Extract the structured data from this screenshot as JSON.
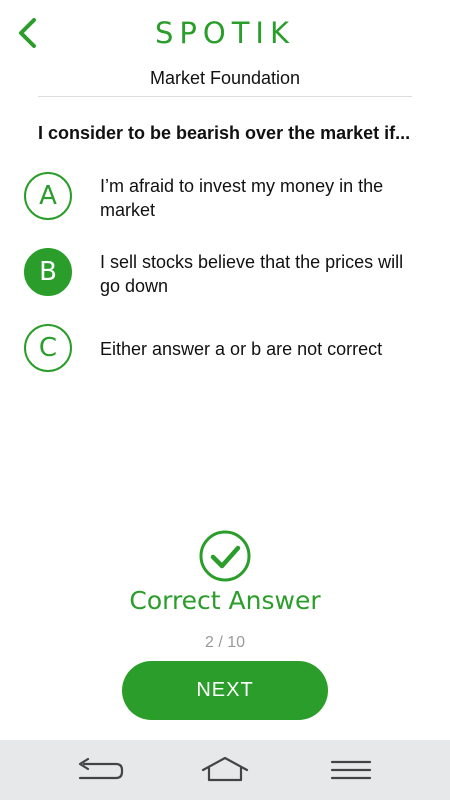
{
  "header": {
    "brand": "SPOTIK",
    "back_icon": "chevron-left-icon",
    "subtitle": "Market Foundation"
  },
  "question": {
    "text": "I consider to be bearish over the market if..."
  },
  "options": [
    {
      "letter": "A",
      "text": "I’m afraid to invest my money in the market",
      "selected": false
    },
    {
      "letter": "B",
      "text": "I sell stocks believe that the prices will go down",
      "selected": true
    },
    {
      "letter": "C",
      "text": "Either answer a or b are not correct",
      "selected": false
    }
  ],
  "result": {
    "icon": "check-circle-icon",
    "text": "Correct Answer"
  },
  "progress": "2 / 10",
  "next_button": "NEXT",
  "navbar": {
    "icons": [
      "back-nav-icon",
      "home-nav-icon",
      "menu-nav-icon"
    ]
  },
  "colors": {
    "accent": "#2a9d2a",
    "navbar_bg": "#e6e8ea",
    "muted": "#9a9a9a"
  }
}
